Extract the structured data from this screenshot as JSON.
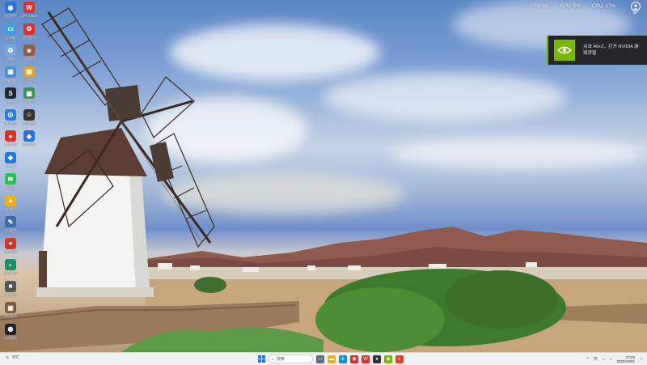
{
  "desktop": {
    "icons": [
      {
        "name": "icon-1",
        "label": "应用程序",
        "color": "#2a72d8",
        "glyph": "◉"
      },
      {
        "name": "icon-2",
        "label": "此电脑",
        "color": "#3aa0e0",
        "glyph": "▭"
      },
      {
        "name": "icon-3",
        "label": "回收站",
        "color": "#7aa7d6",
        "glyph": "♻"
      },
      {
        "name": "icon-4",
        "label": "控制面板",
        "color": "#4c8fd0",
        "glyph": "▣"
      },
      {
        "name": "icon-5",
        "label": "Steam",
        "color": "#1b2838",
        "glyph": "S"
      },
      {
        "name": "icon-6",
        "label": "应用程序",
        "color": "#2f7bd6",
        "glyph": "◎"
      },
      {
        "name": "icon-7",
        "label": "应用程序",
        "color": "#d9362b",
        "glyph": "●"
      },
      {
        "name": "icon-8",
        "label": "ToDesk",
        "color": "#1f7ae0",
        "glyph": "◆"
      },
      {
        "name": "icon-9",
        "label": "微信",
        "color": "#2bbd5a",
        "glyph": "✉"
      },
      {
        "name": "icon-10",
        "label": "应用程序",
        "color": "#e8b21c",
        "glyph": "▲"
      },
      {
        "name": "icon-11",
        "label": "应用程序",
        "color": "#3b6ea8",
        "glyph": "✎"
      },
      {
        "name": "icon-12",
        "label": "应用程序",
        "color": "#c93b2f",
        "glyph": "●"
      },
      {
        "name": "icon-13",
        "label": "应用程序",
        "color": "#1f8f6a",
        "glyph": "◐"
      },
      {
        "name": "icon-14",
        "label": "应用程序",
        "color": "#555555",
        "glyph": "■"
      },
      {
        "name": "icon-15",
        "label": "应用程序",
        "color": "#7d5a3c",
        "glyph": "▣"
      },
      {
        "name": "icon-16",
        "label": "应用程序",
        "color": "#222222",
        "glyph": "◉"
      },
      {
        "name": "icon-17",
        "label": "WPS Office",
        "color": "#d8322b",
        "glyph": "W"
      },
      {
        "name": "icon-18",
        "label": "应用程序",
        "color": "#d8322b",
        "glyph": "✿"
      },
      {
        "name": "icon-19",
        "label": "应用程序",
        "color": "#9b5b3a",
        "glyph": "☻"
      },
      {
        "name": "icon-20",
        "label": "应用程序",
        "color": "#d9a52b",
        "glyph": "▤"
      },
      {
        "name": "icon-21",
        "label": "应用程序",
        "color": "#3b8f5a",
        "glyph": "▦"
      },
      {
        "name": "icon-22",
        "label": "应用程序",
        "color": "#333333",
        "glyph": "☺"
      },
      {
        "name": "icon-23",
        "label": "应用程序",
        "color": "#2a72d8",
        "glyph": "◆"
      }
    ]
  },
  "overlay": {
    "perf": [
      {
        "label": "FPS",
        "value": "60"
      },
      {
        "label": "GPU",
        "value": "9%"
      },
      {
        "label": "CPU",
        "value": "17%"
      }
    ],
    "user_label": "用户"
  },
  "toast": {
    "message": "点击 Alt+Z，打开 NVIDIA 游戏浮窗"
  },
  "taskbar": {
    "left_text": "9°C",
    "search_placeholder": "搜索",
    "clock_time": "17:23",
    "clock_date": "2025/10/21",
    "lang": "中"
  }
}
